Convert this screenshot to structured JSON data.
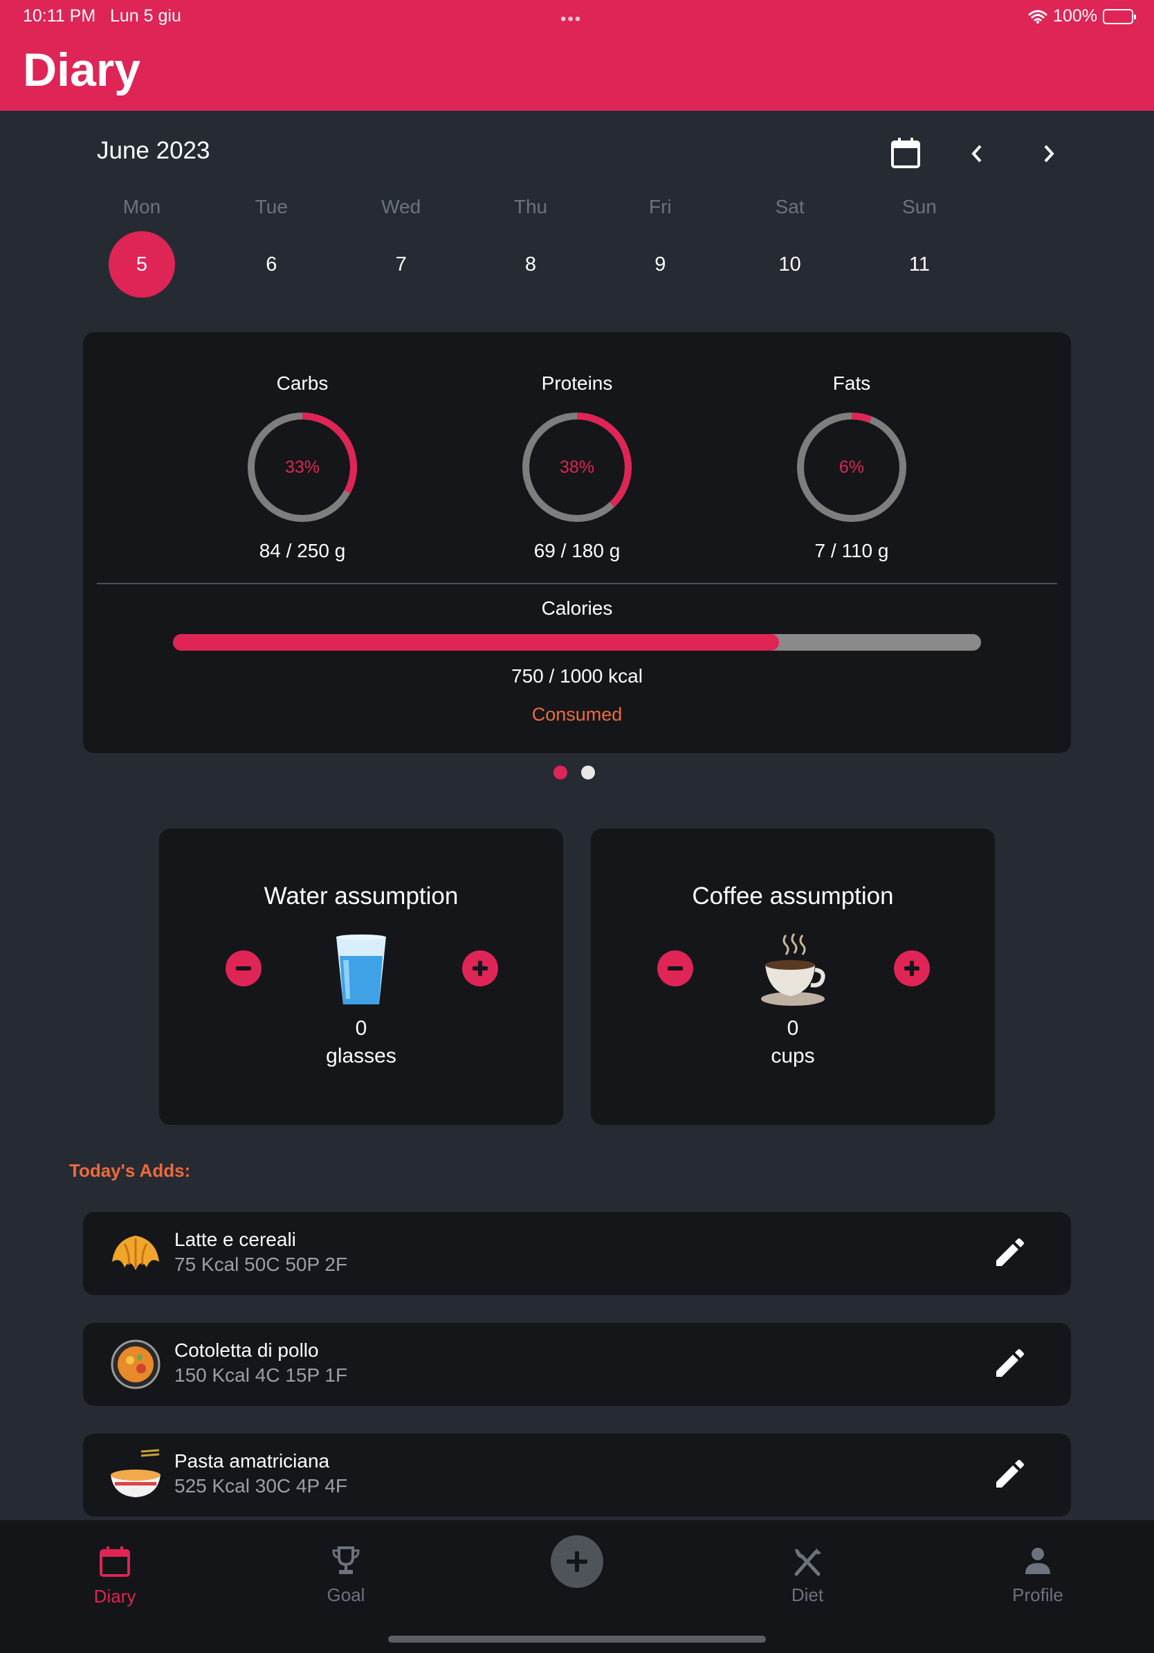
{
  "status_bar": {
    "time": "10:11 PM",
    "date": "Lun 5 giu",
    "battery": "100%"
  },
  "header": {
    "title": "Diary"
  },
  "calendar": {
    "month": "June 2023",
    "days": [
      {
        "name": "Mon",
        "number": "5",
        "selected": true
      },
      {
        "name": "Tue",
        "number": "6"
      },
      {
        "name": "Wed",
        "number": "7"
      },
      {
        "name": "Thu",
        "number": "8"
      },
      {
        "name": "Fri",
        "number": "9"
      },
      {
        "name": "Sat",
        "number": "10"
      },
      {
        "name": "Sun",
        "number": "11"
      }
    ]
  },
  "macros": [
    {
      "label": "Carbs",
      "percent_text": "33%",
      "fraction": 0.33,
      "amount": "84 / 250 g"
    },
    {
      "label": "Proteins",
      "percent_text": "38%",
      "fraction": 0.38,
      "amount": "69 / 180 g"
    },
    {
      "label": "Fats",
      "percent_text": "6%",
      "fraction": 0.06,
      "amount": "7 / 110 g"
    }
  ],
  "calories": {
    "label": "Calories",
    "amount": "750 / 1000 kcal",
    "fraction": 0.75,
    "status": "Consumed"
  },
  "water": {
    "title": "Water assumption",
    "count": "0",
    "unit": "glasses",
    "icon": "water-glass-icon"
  },
  "coffee": {
    "title": "Coffee assumption",
    "count": "0",
    "unit": "cups",
    "icon": "coffee-cup-icon"
  },
  "todays_adds": {
    "label": "Today's Adds:",
    "items": [
      {
        "name": "Latte e cereali",
        "meta": "75 Kcal 50C 50P 2F",
        "icon": "croissant-icon"
      },
      {
        "name": "Cotoletta di pollo",
        "meta": "150 Kcal 4C 15P 1F",
        "icon": "paella-icon"
      },
      {
        "name": "Pasta amatriciana",
        "meta": "525 Kcal 30C 4P 4F",
        "icon": "noodle-bowl-icon"
      }
    ]
  },
  "bottom_nav": {
    "items": [
      {
        "label": "Diary",
        "icon": "calendar-icon",
        "active": true
      },
      {
        "label": "Goal",
        "icon": "trophy-icon"
      },
      {
        "label": "Diet",
        "icon": "fork-knife-icon"
      },
      {
        "label": "Profile",
        "icon": "person-icon"
      }
    ],
    "center_icon": "plus-icon"
  },
  "colors": {
    "accent": "#df2456",
    "background": "#262b33",
    "card": "#141619",
    "highlight": "#f06a3c",
    "muted": "#6c737f",
    "ring_track": "#7e7e7e"
  }
}
